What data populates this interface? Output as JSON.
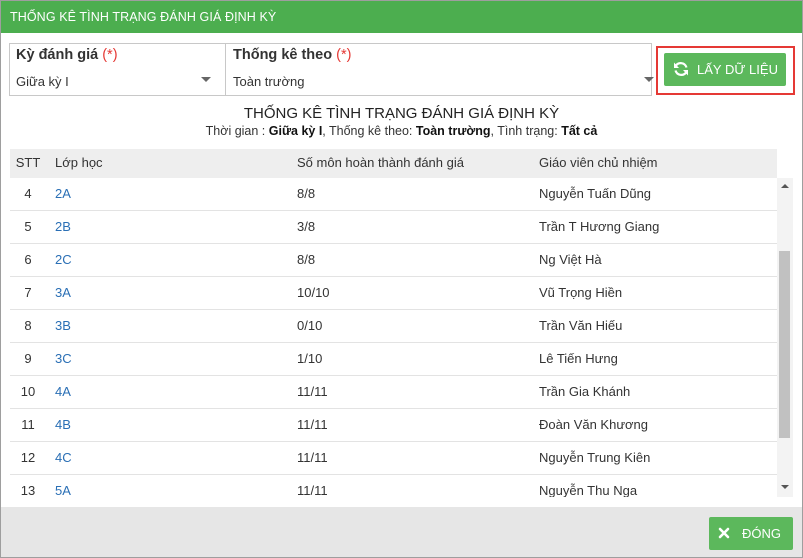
{
  "dialog": {
    "title": "THỐNG KÊ TÌNH TRẠNG ĐÁNH GIÁ ĐỊNH KỲ"
  },
  "filters": {
    "period": {
      "label": "Kỳ đánh giá",
      "required_mark": "(*)",
      "value": "Giữa kỳ I"
    },
    "scope": {
      "label": "Thống kê theo",
      "required_mark": "(*)",
      "value": "Toàn trường"
    }
  },
  "get_data_button": {
    "label": "LẤY DỮ LIỆU",
    "icon": "refresh-icon"
  },
  "report": {
    "title": "THỐNG KÊ TÌNH TRẠNG ĐÁNH GIÁ ĐỊNH KỲ",
    "time_label": "Thời gian : ",
    "time_value": "Giữa kỳ I",
    "scope_label": ", Thống kê theo: ",
    "scope_value": "Toàn trường",
    "status_label": ", Tình trạng: ",
    "status_value": "Tất cả"
  },
  "table": {
    "columns": [
      "STT",
      "Lớp học",
      "Số môn hoàn thành đánh giá",
      "Giáo viên chủ nhiệm"
    ],
    "rows": [
      {
        "stt": "4",
        "class": "2A",
        "completed": "8/8",
        "teacher": "Nguyễn Tuấn Dũng"
      },
      {
        "stt": "5",
        "class": "2B",
        "completed": "3/8",
        "teacher": "Trần T Hương Giang"
      },
      {
        "stt": "6",
        "class": "2C",
        "completed": "8/8",
        "teacher": "Ng Việt Hà"
      },
      {
        "stt": "7",
        "class": "3A",
        "completed": "10/10",
        "teacher": "Vũ Trọng Hiền"
      },
      {
        "stt": "8",
        "class": "3B",
        "completed": "0/10",
        "teacher": "Trần Văn Hiếu"
      },
      {
        "stt": "9",
        "class": "3C",
        "completed": "1/10",
        "teacher": "Lê Tiến Hưng"
      },
      {
        "stt": "10",
        "class": "4A",
        "completed": "11/11",
        "teacher": "Trần Gia Khánh"
      },
      {
        "stt": "11",
        "class": "4B",
        "completed": "11/11",
        "teacher": "Đoàn Văn Khương"
      },
      {
        "stt": "12",
        "class": "4C",
        "completed": "11/11",
        "teacher": "Nguyễn Trung Kiên"
      },
      {
        "stt": "13",
        "class": "5A",
        "completed": "11/11",
        "teacher": "Nguyễn Thu Nga"
      }
    ]
  },
  "close_button": {
    "label": "ĐÓNG",
    "icon": "close-icon"
  },
  "colors": {
    "header_green": "#4cae4f",
    "button_green": "#5cb85c",
    "highlight_red": "#e53935",
    "link_blue": "#2a6fb5"
  }
}
